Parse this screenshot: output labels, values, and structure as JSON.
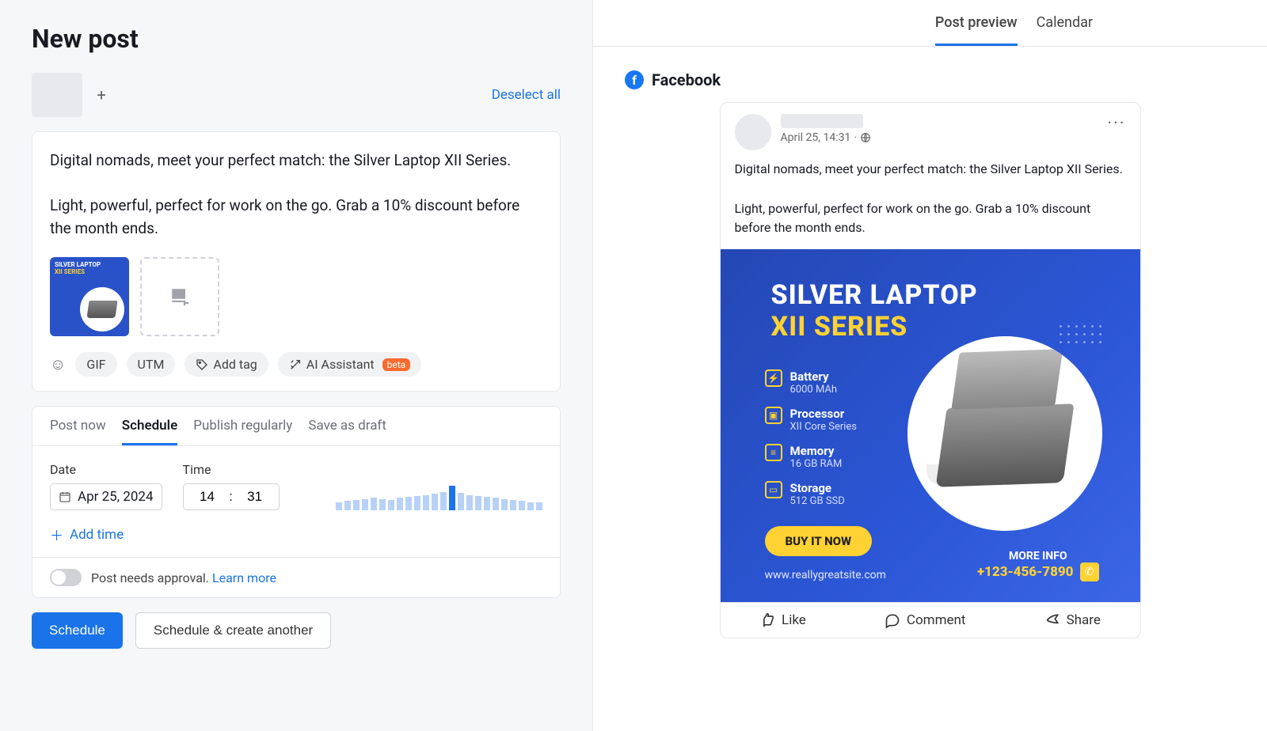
{
  "header": {
    "title": "New post"
  },
  "accounts": {
    "deselect": "Deselect all"
  },
  "composer": {
    "text": "Digital nomads, meet your perfect match: the Silver Laptop XII Series.\n\nLight, powerful, perfect for work on the go. Grab a 10% discount before the month ends.",
    "thumb_title": "SILVER LAPTOP",
    "thumb_sub": "XII SERIES",
    "tools": {
      "gif": "GIF",
      "utm": "UTM",
      "add_tag": "Add tag",
      "ai": "AI Assistant",
      "beta": "beta"
    }
  },
  "schedule": {
    "tabs": [
      "Post now",
      "Schedule",
      "Publish regularly",
      "Save as draft"
    ],
    "active_tab_index": 1,
    "date_label": "Date",
    "time_label": "Time",
    "date_value": "Apr 25, 2024",
    "hour": "14",
    "minute": "31",
    "colon": ":",
    "add_time": "Add time",
    "bars": [
      8,
      9,
      10,
      11,
      12,
      11,
      10,
      12,
      13,
      14,
      15,
      16,
      18,
      24,
      17,
      15,
      14,
      13,
      12,
      11,
      10,
      9,
      8,
      8
    ],
    "bar_highlight_index": 13
  },
  "approval": {
    "text": "Post needs approval.",
    "learn_more": "Learn more"
  },
  "actions": {
    "primary": "Schedule",
    "secondary": "Schedule & create another"
  },
  "right": {
    "tabs": [
      "Post preview",
      "Calendar"
    ],
    "active_tab_index": 0,
    "platform": "Facebook"
  },
  "post": {
    "timestamp": "April 25, 14:31",
    "dot": "·",
    "text": "Digital nomads, meet your perfect match: the Silver Laptop XII Series.\n\nLight, powerful, perfect for work on the go. Grab a 10% discount before the month ends.",
    "ad": {
      "title": "SILVER LAPTOP",
      "subtitle": "XII SERIES",
      "specs": [
        {
          "icon": "⚡",
          "label": "Battery",
          "sub": "6000 MAh"
        },
        {
          "icon": "▣",
          "label": "Processor",
          "sub": "XII Core Series"
        },
        {
          "icon": "≡",
          "label": "Memory",
          "sub": "16 GB RAM"
        },
        {
          "icon": "▭",
          "label": "Storage",
          "sub": "512 GB SSD"
        }
      ],
      "buy": "BUY IT NOW",
      "site": "www.reallygreatsite.com",
      "more_info": "MORE INFO",
      "phone": "+123-456-7890"
    },
    "actions": {
      "like": "Like",
      "comment": "Comment",
      "share": "Share"
    }
  }
}
